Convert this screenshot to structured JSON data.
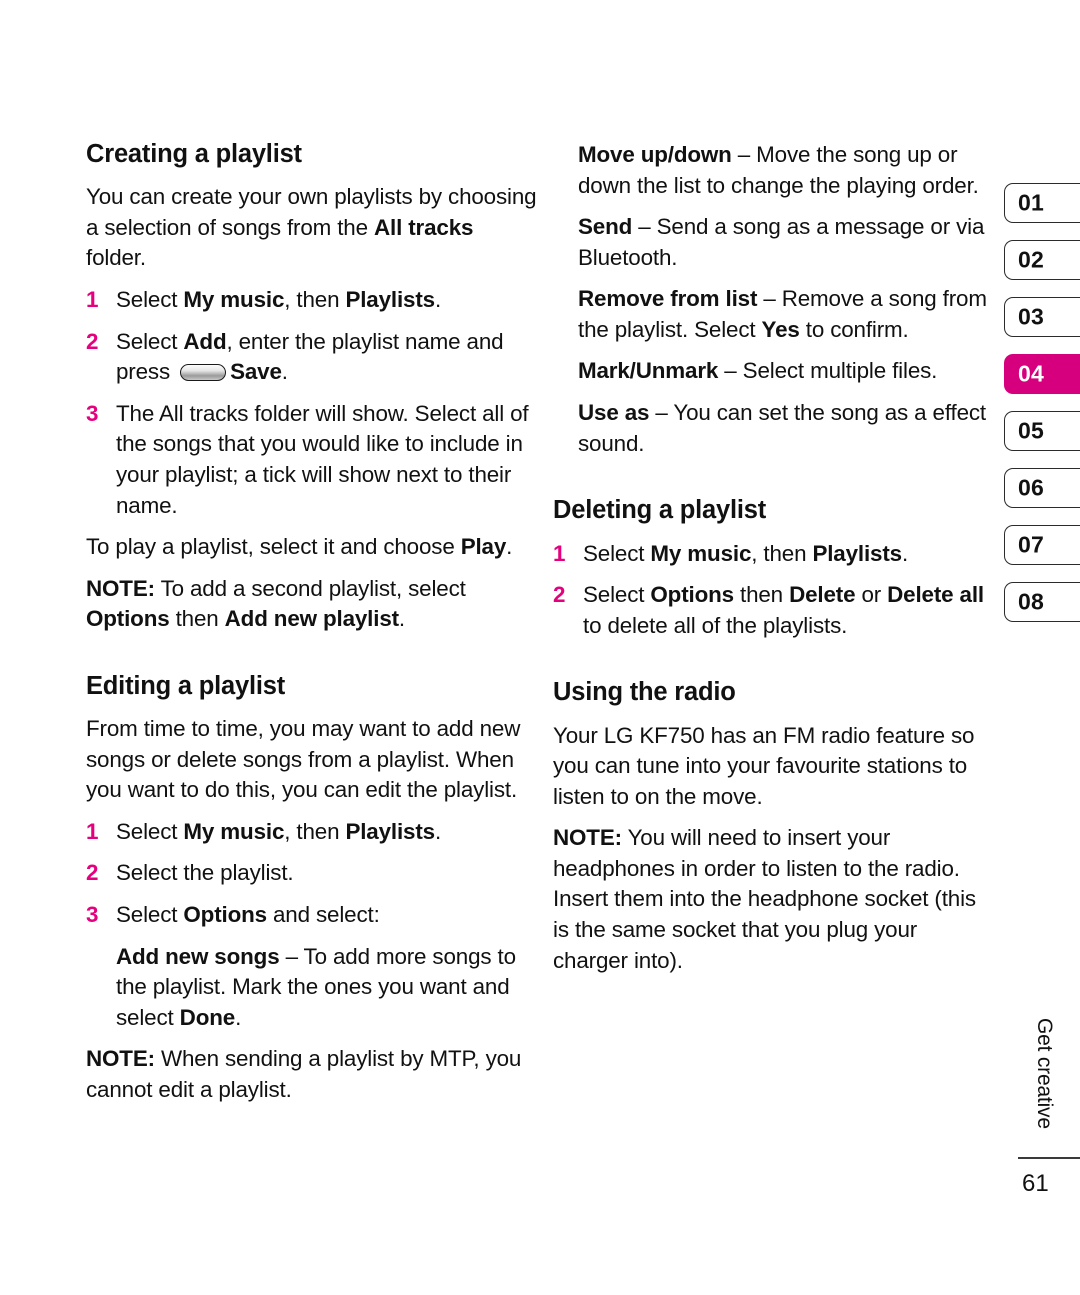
{
  "page": {
    "number": "61",
    "running_head": "Get creative",
    "accent_color": "#e5007d",
    "tab_active_color": "#d6007f"
  },
  "tabs": [
    {
      "label": "01",
      "active": false
    },
    {
      "label": "02",
      "active": false
    },
    {
      "label": "03",
      "active": false
    },
    {
      "label": "04",
      "active": true
    },
    {
      "label": "05",
      "active": false
    },
    {
      "label": "06",
      "active": false
    },
    {
      "label": "07",
      "active": false
    },
    {
      "label": "08",
      "active": false
    }
  ],
  "left_column": {
    "creating": {
      "heading": "Creating a playlist",
      "intro_a": "You can create your own playlists by choosing a selection of songs from the ",
      "intro_b": "All tracks",
      "intro_c": " folder.",
      "steps": [
        {
          "num": "1",
          "a": "Select ",
          "b": "My music",
          "c": ", then ",
          "d": "Playlists",
          "e": "."
        },
        {
          "num": "2",
          "a": "Select ",
          "b": "Add",
          "c": ", enter the playlist name and press ",
          "d": "Save",
          "e": ".",
          "icon": "softkey-icon"
        },
        {
          "num": "3",
          "a": "The All tracks folder will show. Select all of the songs that you would like to include in your playlist; a tick will show next to their name."
        }
      ],
      "play_a": "To play a playlist, select it and choose ",
      "play_b": "Play",
      "play_c": ".",
      "note_label": "NOTE:",
      "note_a": " To add a second playlist, select ",
      "note_b": "Options",
      "note_c": " then ",
      "note_d": "Add new playlist",
      "note_e": "."
    },
    "editing": {
      "heading": "Editing a playlist",
      "intro": "From time to time, you may want to add new songs or delete songs from a playlist. When you want to do this, you can edit the playlist.",
      "steps": [
        {
          "num": "1",
          "a": "Select ",
          "b": "My music",
          "c": ", then ",
          "d": "Playlists",
          "e": "."
        },
        {
          "num": "2",
          "a": "Select the playlist."
        },
        {
          "num": "3",
          "a": "Select ",
          "b": "Options",
          "c": " and select:"
        }
      ],
      "option_add": {
        "term": "Add new songs",
        "dash": " – ",
        "desc_a": "To add more songs to the playlist. Mark the ones you want and select ",
        "desc_b": "Done",
        "desc_c": "."
      },
      "note_label": "NOTE:",
      "note_text": " When sending a playlist by MTP, you cannot edit a playlist."
    }
  },
  "right_column": {
    "options_continued": [
      {
        "term": "Move up/down",
        "dash": " – ",
        "desc": "Move the song up or down the list to change the playing order."
      },
      {
        "term": "Send",
        "dash": " – ",
        "desc": "Send a song as a message or via Bluetooth."
      },
      {
        "term": "Remove from list",
        "dash": " – ",
        "desc_a": "Remove a song from the playlist. Select ",
        "desc_b": "Yes",
        "desc_c": " to confirm."
      },
      {
        "term": "Mark/Unmark",
        "dash": " – ",
        "desc": "Select multiple files."
      },
      {
        "term": "Use as",
        "dash": " – ",
        "desc": "You can set the song as a effect sound."
      }
    ],
    "deleting": {
      "heading": "Deleting a playlist",
      "steps": [
        {
          "num": "1",
          "a": "Select ",
          "b": "My music",
          "c": ", then ",
          "d": "Playlists",
          "e": "."
        },
        {
          "num": "2",
          "a": "Select ",
          "b": "Options",
          "c": " then ",
          "d": "Delete",
          "e": " or ",
          "f": "Delete all",
          "g": " to delete all of the playlists."
        }
      ]
    },
    "radio": {
      "heading": "Using the radio",
      "intro": "Your LG KF750 has an FM radio feature so you can tune into your favourite stations to listen to on the move.",
      "note_label": "NOTE:",
      "note_text": " You will need to insert your headphones in order to listen to the radio. Insert them into the headphone socket (this is the same socket that you plug your charger into)."
    }
  }
}
